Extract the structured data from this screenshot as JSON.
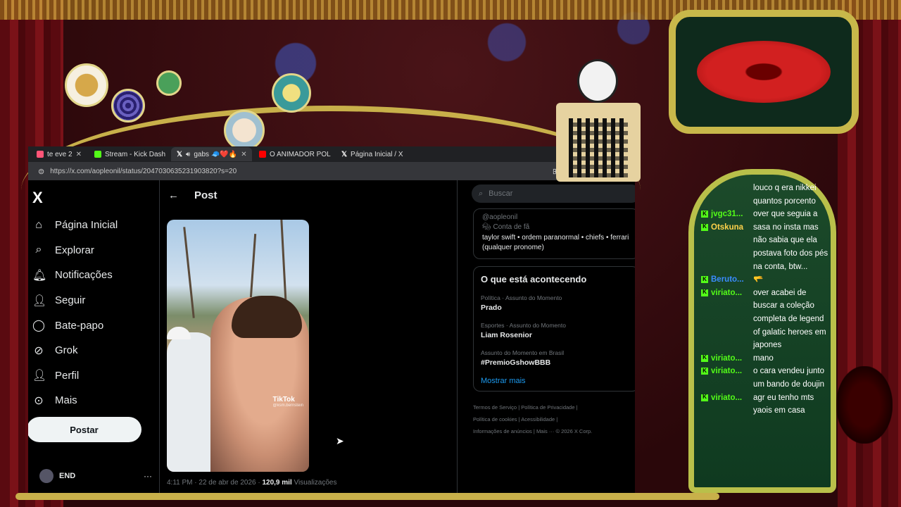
{
  "browser": {
    "tabs": [
      {
        "label": "te eve 2",
        "color": "#ff5577"
      },
      {
        "label": "Stream - Kick Dash",
        "color": "#53fc18"
      },
      {
        "label": "gabs 🧢❤️🔥",
        "color": "#ffffff"
      },
      {
        "label": "O ANIMADOR POL",
        "color": "#ff0000"
      },
      {
        "label": "Página Inicial / X",
        "color": "#ffffff"
      }
    ],
    "url": "https://x.com/aopleonil/status/2047030635231903820?s=20"
  },
  "x": {
    "logo": "X",
    "nav": [
      {
        "label": "Página Inicial",
        "icon": "home-icon",
        "glyph": "⌂"
      },
      {
        "label": "Explorar",
        "icon": "search-icon",
        "glyph": "⌕"
      },
      {
        "label": "Notificações",
        "icon": "bell-icon",
        "glyph": "🔔︎"
      },
      {
        "label": "Seguir",
        "icon": "add-person-icon",
        "glyph": "👤︎"
      },
      {
        "label": "Bate-papo",
        "icon": "chat-bubble-icon",
        "glyph": "◯"
      },
      {
        "label": "Grok",
        "icon": "grok-icon",
        "glyph": "⊘"
      },
      {
        "label": "Perfil",
        "icon": "profile-icon",
        "glyph": "👤︎"
      },
      {
        "label": "Mais",
        "icon": "more-circle-icon",
        "glyph": "⊙"
      }
    ],
    "post_button": "Postar",
    "account_name": "END",
    "header_title": "Post",
    "video_watermark": "TikTok",
    "video_watermark_handle": "@ksm.bernstein",
    "post_meta": {
      "time": "4:11 PM",
      "date": "22 de abr de 2026",
      "views_count": "120,9 mil",
      "views_label": "Visualizações"
    },
    "search_placeholder": "Buscar",
    "profile": {
      "handle": "@aopleonil",
      "fan_label": "Conta de fã",
      "bio": "taylor swift • ordem paranormal • chiefs • ferrari (qualquer pronome)"
    },
    "trends_title": "O que está acontecendo",
    "trends": [
      {
        "category": "Política · Assunto do Momento",
        "topic": "Prado"
      },
      {
        "category": "Esportes · Assunto do Momento",
        "topic": "Liam Rosenior"
      },
      {
        "category": "Assunto do Momento em Brasil",
        "topic": "#PremioGshowBBB"
      }
    ],
    "show_more": "Mostrar mais",
    "footer": {
      "terms": "Termos de Serviço",
      "privacy": "Política de Privacidade",
      "cookies": "Política de cookies",
      "accessibility": "Acessibilidade",
      "ads": "Informações de anúncios",
      "more": "Mais ···",
      "copyright": "© 2026 X Corp."
    }
  },
  "chat": {
    "messages": [
      {
        "user": "",
        "user_color": "#ffffff",
        "text": "louco q era nikkei quantos porcento"
      },
      {
        "user": "jvgc31...",
        "user_color": "#53fc18",
        "text": "over que seguia a"
      },
      {
        "user": "Otskuna",
        "user_color": "#ffd24a",
        "text": "sasa no insta mas não sabia que ela postava foto dos pés na conta, btw..."
      },
      {
        "user": "Beruto...",
        "user_color": "#3a8cff",
        "text": "🫳"
      },
      {
        "user": "viriato...",
        "user_color": "#53fc18",
        "text": "over acabei de buscar a coleção completa de legend of galatic heroes em japones"
      },
      {
        "user": "viriato...",
        "user_color": "#53fc18",
        "text": "mano"
      },
      {
        "user": "viriato...",
        "user_color": "#53fc18",
        "text": "o cara vendeu junto um bando de doujin"
      },
      {
        "user": "viriato...",
        "user_color": "#53fc18",
        "text": "agr eu tenho mts yaois em casa"
      }
    ]
  }
}
